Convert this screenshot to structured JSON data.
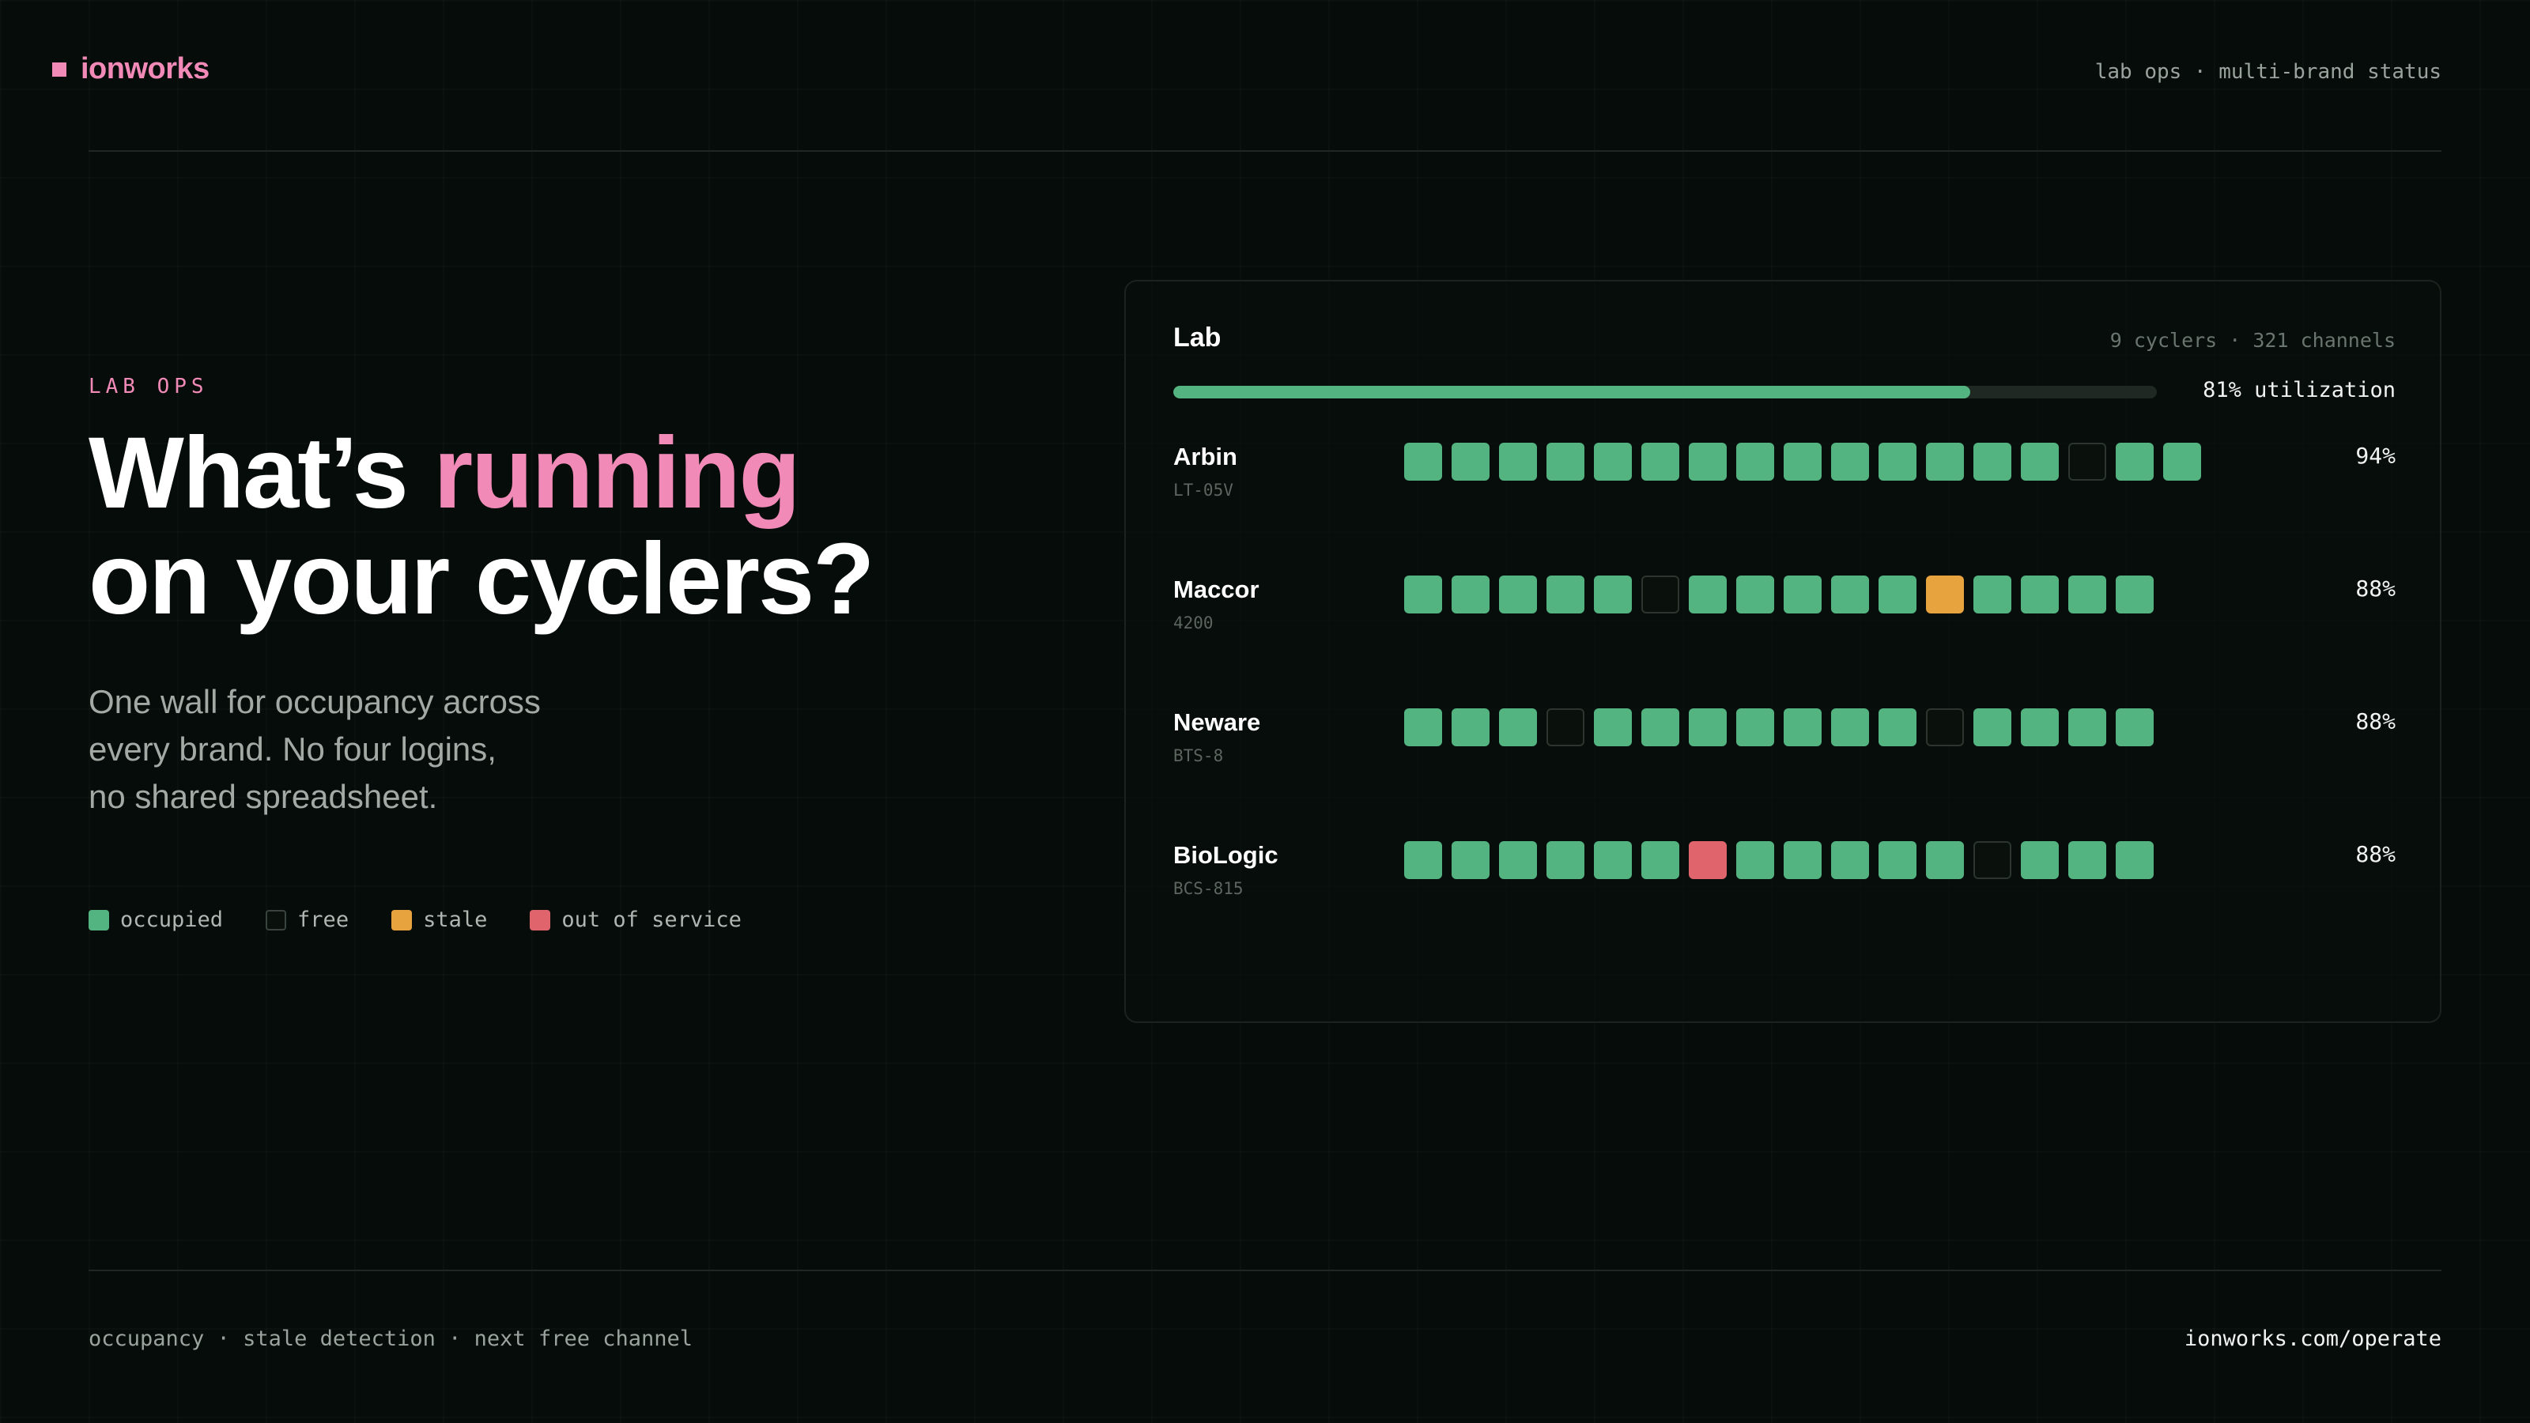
{
  "header": {
    "brand": "ionworks",
    "tagline": "lab ops · multi-brand status"
  },
  "hero": {
    "eyebrow": "LAB OPS",
    "headline_pre": "What’s ",
    "headline_accent": "running",
    "headline_line2": "on your cyclers?",
    "subtitle_lines": [
      "One wall for occupancy across",
      "every brand. No four logins,",
      "no shared spreadsheet."
    ]
  },
  "legend": [
    {
      "state": "occupied",
      "label": "occupied",
      "color": "#53b482"
    },
    {
      "state": "free",
      "label": "free",
      "color": "#0a110d"
    },
    {
      "state": "stale",
      "label": "stale",
      "color": "#e6a33e"
    },
    {
      "state": "out_of_service",
      "label": "out of service",
      "color": "#df646c"
    }
  ],
  "panel": {
    "title": "Lab",
    "meta": "9 cyclers · 321 channels",
    "utilization": 0.81,
    "utilization_label": "81% utilization",
    "cyclers": [
      {
        "name": "Arbin",
        "model": "LT-05V",
        "percent": "94%",
        "channels": [
          "occupied",
          "occupied",
          "occupied",
          "occupied",
          "occupied",
          "occupied",
          "occupied",
          "occupied",
          "occupied",
          "occupied",
          "occupied",
          "occupied",
          "occupied",
          "occupied",
          "free",
          "occupied",
          "occupied"
        ]
      },
      {
        "name": "Maccor",
        "model": "4200",
        "percent": "88%",
        "channels": [
          "occupied",
          "occupied",
          "occupied",
          "occupied",
          "occupied",
          "free",
          "occupied",
          "occupied",
          "occupied",
          "occupied",
          "occupied",
          "stale",
          "occupied",
          "occupied",
          "occupied",
          "occupied"
        ]
      },
      {
        "name": "Neware",
        "model": "BTS-8",
        "percent": "88%",
        "channels": [
          "occupied",
          "occupied",
          "occupied",
          "free",
          "occupied",
          "occupied",
          "occupied",
          "occupied",
          "occupied",
          "occupied",
          "occupied",
          "free",
          "occupied",
          "occupied",
          "occupied",
          "occupied"
        ]
      },
      {
        "name": "BioLogic",
        "model": "BCS-815",
        "percent": "88%",
        "channels": [
          "occupied",
          "occupied",
          "occupied",
          "occupied",
          "occupied",
          "occupied",
          "out_of_service",
          "occupied",
          "occupied",
          "occupied",
          "occupied",
          "occupied",
          "free",
          "occupied",
          "occupied",
          "occupied"
        ]
      }
    ]
  },
  "footer": {
    "features": "occupancy · stale detection · next free channel",
    "link": "ionworks.com/operate"
  }
}
